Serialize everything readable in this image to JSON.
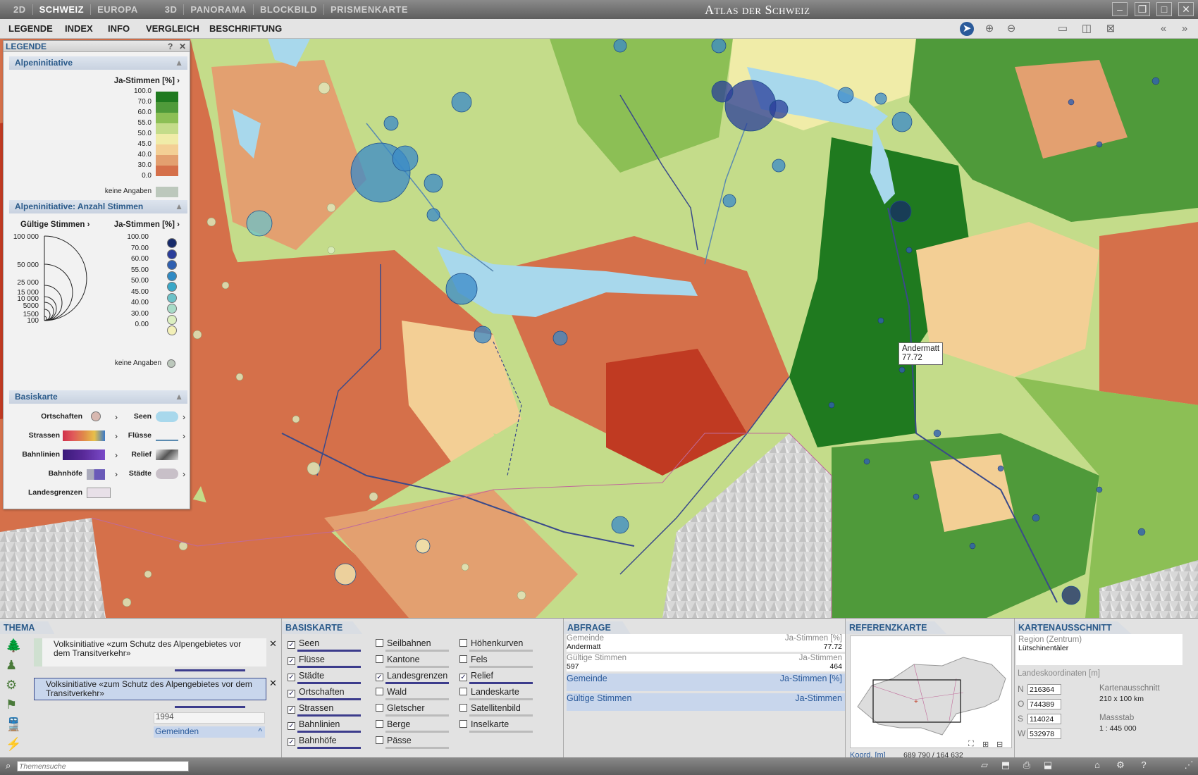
{
  "titlebar": {
    "modes": [
      "2D",
      "SCHWEIZ",
      "EUROPA",
      "3D",
      "PANORAMA",
      "BLOCKBILD",
      "PRISMENKARTE"
    ],
    "app_title": "Atlas der Schweiz"
  },
  "menu": {
    "items": [
      "LEGENDE",
      "INDEX",
      "INFO",
      "VERGLEICH",
      "BESCHRIFTUNG"
    ]
  },
  "legend": {
    "title": "LEGENDE",
    "help": "?",
    "close": "✕",
    "sec1": {
      "title": "Alpeninitiative",
      "subtitle": "Ja-Stimmen [%]",
      "classes": [
        "100.0",
        "70.0",
        "60.0",
        "55.0",
        "50.0",
        "45.0",
        "40.0",
        "30.0",
        "0.0"
      ],
      "colors": [
        "#1f7a1f",
        "#4f9a3a",
        "#8cbf55",
        "#c4dc8a",
        "#f0eca8",
        "#f3cf95",
        "#e3a070",
        "#d5704a",
        "#c03a22"
      ],
      "no_data": "keine Angaben"
    },
    "sec2": {
      "title": "Alpeninitiative: Anzahl Stimmen",
      "left_label": "Gültige Stimmen",
      "right_label": "Ja-Stimmen [%]",
      "sizes": [
        "100 000",
        "50 000",
        "25 000",
        "15 000",
        "10 000",
        "5000",
        "1500",
        "100"
      ],
      "classes": [
        "100.00",
        "70.00",
        "60.00",
        "55.00",
        "50.00",
        "45.00",
        "40.00",
        "30.00",
        "0.00"
      ],
      "colors": [
        "#172a6a",
        "#2a3d9a",
        "#2f5fb0",
        "#2f8ac4",
        "#3aa8c8",
        "#6cc2c8",
        "#a8dcc8",
        "#dcefc0",
        "#f3f0b8"
      ],
      "no_data": "keine Angaben"
    },
    "sec3": {
      "title": "Basiskarte",
      "items": [
        "Ortschaften",
        "Strassen",
        "Bahnlinien",
        "Bahnhöfe",
        "Landesgrenzen",
        "Seen",
        "Flüsse",
        "Relief",
        "Städte"
      ]
    }
  },
  "map": {
    "tooltip_name": "Andermatt",
    "tooltip_value": "77.72"
  },
  "thema": {
    "title": "THEMA",
    "item1": "Volksinitiative «zum Schutz des Alpengebietes vor dem Transitverkehr»",
    "item2": "Volksinitiative «zum Schutz des Alpengebietes vor dem Transitverkehr»",
    "year": "1994",
    "level": "Gemeinden"
  },
  "basiskarte": {
    "title": "BASISKARTE",
    "col1": [
      "Seen",
      "Flüsse",
      "Städte",
      "Ortschaften",
      "Strassen",
      "Bahnlinien",
      "Bahnhöfe"
    ],
    "col2": [
      "Seilbahnen",
      "Kantone",
      "Landesgrenzen",
      "Wald",
      "Gletscher",
      "Berge",
      "Pässe"
    ],
    "col3": [
      "Höhenkurven",
      "Fels",
      "Relief",
      "Landeskarte",
      "Satellitenbild",
      "Inselkarte"
    ]
  },
  "abfrage": {
    "title": "ABFRAGE",
    "r1_label": "Gemeinde",
    "r1_right": "Ja-Stimmen [%]",
    "r1_val_l": "Andermatt",
    "r1_val_r": "77.72",
    "r2_label": "Gültige Stimmen",
    "r2_right": "Ja-Stimmen",
    "r2_val_l": "597",
    "r2_val_r": "464",
    "r3_label": "Gemeinde",
    "r3_right": "Ja-Stimmen [%]",
    "r4_label": "Gültige Stimmen",
    "r4_right": "Ja-Stimmen"
  },
  "referenz": {
    "title": "REFERENZKARTE",
    "koord_label": "Koord. [m]",
    "koord_value": "689 790 / 164 632"
  },
  "ausschnitt": {
    "title": "KARTENAUSSCHNITT",
    "region": "Region (Zentrum)",
    "region_value": "Lütschinentäler",
    "coord_title": "Landeskoordinaten [m]",
    "N": "216364",
    "O": "744389",
    "S": "114024",
    "W": "532978",
    "ka_label": "Kartenausschnitt",
    "ka_value": "210 x 100 km",
    "scale_label": "Massstab",
    "scale_value": "1 : 445 000",
    "n_lbl": "N",
    "o_lbl": "O",
    "s_lbl": "S",
    "w_lbl": "W"
  },
  "status": {
    "search_placeholder": "Themensuche"
  }
}
